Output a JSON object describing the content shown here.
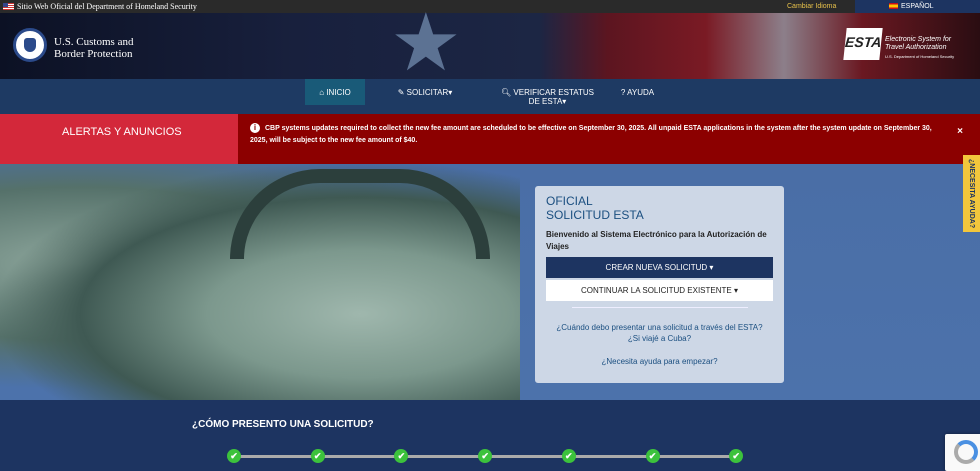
{
  "topbar": {
    "official": "Sitio Web Oficial del Department of Homeland Security",
    "change_language": "Cambiar Idioma",
    "language": "ESPAÑOL"
  },
  "header": {
    "agency_line1": "U.S. Customs and",
    "agency_line2": "Border Protection",
    "esta_logo": "ESTA",
    "esta_name_line1": "Electronic System for",
    "esta_name_line2": "Travel Authorization",
    "esta_dept": "U.S. Department of Homeland Security"
  },
  "nav": {
    "items": [
      {
        "label": "Inicio",
        "icon": "home-icon"
      },
      {
        "label": "Solicitar▾",
        "icon": "pencil-icon"
      },
      {
        "label": "Verificar Estatus de ESTA▾",
        "icon": "search-icon"
      },
      {
        "label": "Ayuda",
        "icon": "question-icon"
      }
    ]
  },
  "alerts": {
    "heading": "ALERTAS Y ANUNCIOS",
    "message": "CBP systems updates required to collect the new fee amount are scheduled to be effective on September 30, 2025. All unpaid ESTA applications in the system after the system update on September 30, 2025, will be subject to the new fee amount of $40.",
    "close": "×"
  },
  "card": {
    "title_line1": "OFICIAL",
    "title_line2": "SOLICITUD ESTA",
    "welcome": "Bienvenido al Sistema Electrónico para la Autorización de Viajes",
    "new_button": "CREAR NUEVA SOLICITUD ▾",
    "continue_button": "CONTINUAR LA SOLICITUD EXISTENTE ▾",
    "link_when": "¿Cuándo debo presentar una solicitud a través del ESTA?",
    "link_cuba": "¿Si viajé a Cuba?",
    "link_help": "¿Necesita ayuda para empezar?"
  },
  "help_tab": "¿NECESITA AYUDA?",
  "how": {
    "heading": "¿CÓMO PRESENTO UNA SOLICITUD?",
    "steps_completed": 7,
    "check": "✔"
  }
}
